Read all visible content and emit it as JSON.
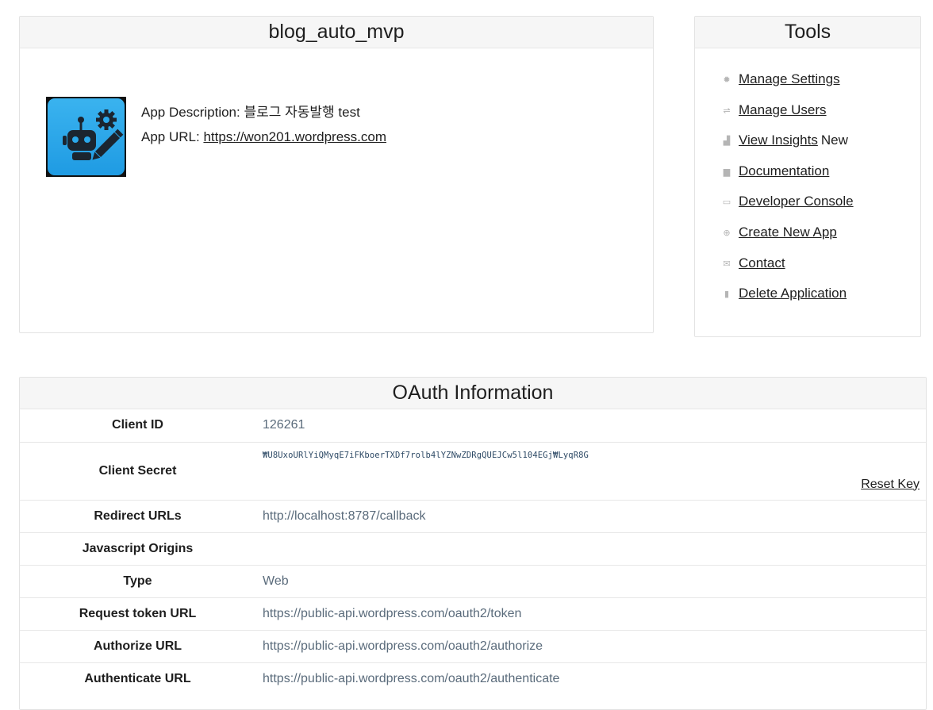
{
  "app": {
    "title": "blog_auto_mvp",
    "description_label": "App Description:",
    "description": "블로그 자동발행 test",
    "url_label": "App URL:",
    "url": "https://won201.wordpress.com"
  },
  "tools": {
    "title": "Tools",
    "items": [
      {
        "icon": "gear-icon",
        "label": "Manage Settings",
        "suffix": ""
      },
      {
        "icon": "users-icon",
        "label": "Manage Users",
        "suffix": ""
      },
      {
        "icon": "bar-chart-icon",
        "label": "View Insights",
        "suffix": "New"
      },
      {
        "icon": "book-icon",
        "label": "Documentation",
        "suffix": ""
      },
      {
        "icon": "console-icon",
        "label": "Developer Console",
        "suffix": ""
      },
      {
        "icon": "plus-circle-icon",
        "label": "Create New App",
        "suffix": ""
      },
      {
        "icon": "mail-icon",
        "label": "Contact",
        "suffix": ""
      },
      {
        "icon": "trash-icon",
        "label": "Delete Application",
        "suffix": ""
      }
    ]
  },
  "oauth": {
    "title": "OAuth Information",
    "client_id_label": "Client ID",
    "client_id": "126261",
    "client_secret_label": "Client Secret",
    "client_secret": "₩U8UxoURlYiQMyqE7iFKboerTXDf7rolb4lYZNwZDRgQUEJCw5l104EGj₩LyqR8G",
    "reset_key": "Reset Key",
    "redirect_label": "Redirect URLs",
    "redirect": "http://localhost:8787/callback",
    "js_origins_label": "Javascript Origins",
    "js_origins": "",
    "type_label": "Type",
    "type": "Web",
    "request_token_label": "Request token URL",
    "request_token": "https://public-api.wordpress.com/oauth2/token",
    "authorize_label": "Authorize URL",
    "authorize": "https://public-api.wordpress.com/oauth2/authorize",
    "authenticate_label": "Authenticate URL",
    "authenticate": "https://public-api.wordpress.com/oauth2/authenticate"
  },
  "colors": {
    "logo_blue": "#2aa8eb",
    "robot_dark": "#1b2530",
    "value_text": "#5a6b7b"
  }
}
